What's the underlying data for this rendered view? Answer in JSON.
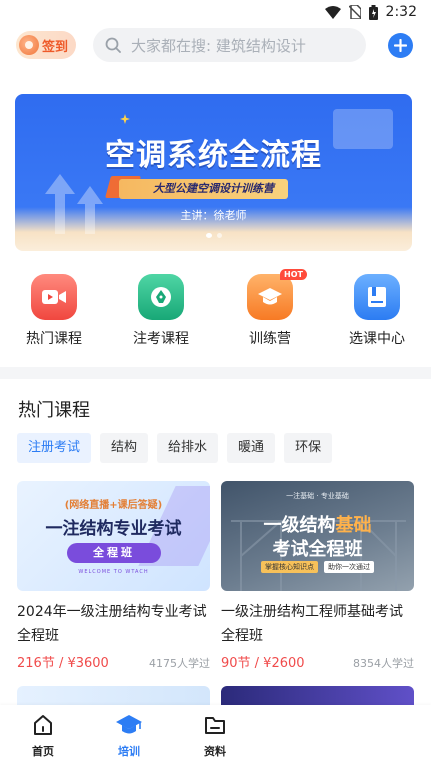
{
  "status_bar": {
    "time": "2:32"
  },
  "header": {
    "checkin_label": "签到",
    "search_placeholder": "大家都在搜: 建筑结构设计",
    "add_icon": "plus-circle-icon"
  },
  "banner": {
    "title": "空调系统全流程",
    "subtitle": "大型公建空调设计训练营",
    "teacher": "主讲：徐老师",
    "slide_count": 2,
    "active_slide": 1
  },
  "quick_nav": [
    {
      "label": "热门课程",
      "icon": "video-icon",
      "color": "#f25b4f"
    },
    {
      "label": "注考课程",
      "icon": "pen-nib-icon",
      "color": "#26b88a"
    },
    {
      "label": "训练营",
      "icon": "graduation-cap-icon",
      "color": "#f98a32",
      "badge": "HOT"
    },
    {
      "label": "选课中心",
      "icon": "book-icon",
      "color": "#3c8ef5"
    }
  ],
  "hot_courses": {
    "title": "热门课程",
    "filters": [
      "注册考试",
      "结构",
      "给排水",
      "暖通",
      "环保"
    ],
    "active_filter": 0,
    "courses": [
      {
        "title": "2024年一级注册结构专业考试全程班",
        "price": "216节 / ¥3600",
        "learners": "4175人学过",
        "thumb_top": "(网络直播+课后答疑)",
        "thumb_main": "一注结构专业考试",
        "thumb_pill": "全程班",
        "thumb_sub": "WELCOME TO WTACH"
      },
      {
        "title": "一级注册结构工程师基础考试全程班",
        "price": "90节 / ¥2600",
        "learners": "8354人学过",
        "thumb_top": "一注基础 · 专业基础",
        "thumb_main_a": "一级结构",
        "thumb_main_b": "基础",
        "thumb_main2": "考试全程班",
        "thumb_tag1": "掌握核心知识点",
        "thumb_tag2": "助你一次通过"
      }
    ]
  },
  "tab_bar": [
    {
      "label": "首页",
      "icon": "home-icon"
    },
    {
      "label": "培训",
      "icon": "graduation-cap-icon",
      "active": true
    },
    {
      "label": "资料",
      "icon": "folder-icon"
    }
  ]
}
